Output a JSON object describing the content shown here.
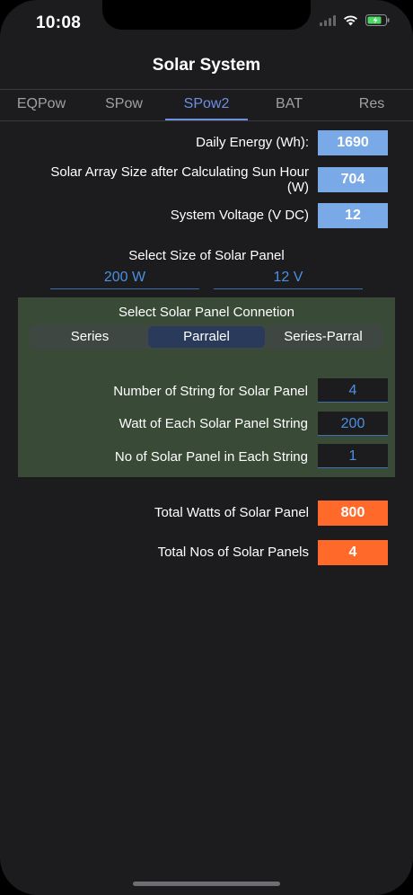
{
  "status": {
    "time": "10:08"
  },
  "nav": {
    "title": "Solar System"
  },
  "tabs": [
    {
      "label": "EQPow",
      "active": false
    },
    {
      "label": "SPow",
      "active": false
    },
    {
      "label": "SPow2",
      "active": true
    },
    {
      "label": "BAT",
      "active": false
    },
    {
      "label": "Res",
      "active": false
    }
  ],
  "summary": {
    "daily_energy_label": "Daily Energy (Wh):",
    "daily_energy_value": "1690",
    "array_size_label_line1": "Solar Array Size after Calculating Sun Hour",
    "array_size_label_line2": "(W)",
    "array_size_value": "704",
    "system_voltage_label": "System Voltage (V DC)",
    "system_voltage_value": "12"
  },
  "panel_size": {
    "title": "Select Size of Solar Panel",
    "watt_value": "200 W",
    "volt_value": "12 V"
  },
  "connection": {
    "title": "Select Solar Panel Connetion",
    "options": [
      "Series",
      "Parralel",
      "Series-Parral"
    ],
    "selected": "Parralel",
    "strings_label": "Number of String for Solar Panel",
    "strings_value": "4",
    "watt_each_label": "Watt of Each Solar Panel String",
    "watt_each_value": "200",
    "panels_each_label": "No of Solar Panel in Each String",
    "panels_each_value": "1"
  },
  "totals": {
    "total_watts_label": "Total Watts of Solar Panel",
    "total_watts_value": "800",
    "total_panels_label": "Total Nos of Solar Panels",
    "total_panels_value": "4"
  },
  "colors": {
    "accent": "#6f8fe0",
    "value_blue": "#7aa9e8",
    "value_orange": "#ff6a2b",
    "panel_green": "#394a37",
    "link_blue": "#4a90e2",
    "battery_green": "#4cd964"
  }
}
